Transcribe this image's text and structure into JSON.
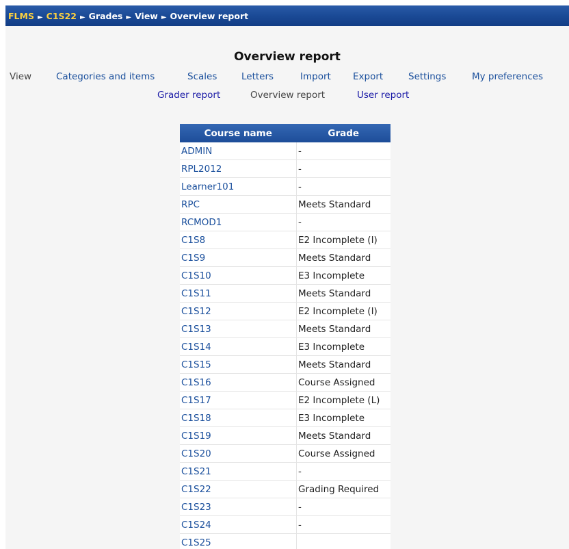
{
  "breadcrumb": {
    "items": [
      {
        "label": "FLMS",
        "link": true
      },
      {
        "label": "C1S22",
        "link": true
      },
      {
        "label": "Grades",
        "link": false
      },
      {
        "label": "View",
        "link": false
      },
      {
        "label": "Overview report",
        "link": false
      }
    ],
    "separator": "►"
  },
  "page_title": "Overview report",
  "tabs": [
    {
      "label": "View",
      "active": true
    },
    {
      "label": "Categories and items",
      "active": false
    },
    {
      "label": "Scales",
      "active": false
    },
    {
      "label": "Letters",
      "active": false
    },
    {
      "label": "Import",
      "active": false
    },
    {
      "label": "Export",
      "active": false
    },
    {
      "label": "Settings",
      "active": false
    },
    {
      "label": "My preferences",
      "active": false
    }
  ],
  "subtabs": [
    {
      "label": "Grader report",
      "active": false
    },
    {
      "label": "Overview report",
      "active": true
    },
    {
      "label": "User report",
      "active": false
    }
  ],
  "table": {
    "headers": [
      "Course name",
      "Grade"
    ],
    "rows": [
      {
        "course": "ADMIN",
        "grade": "-"
      },
      {
        "course": "RPL2012",
        "grade": "-"
      },
      {
        "course": "Learner101",
        "grade": "-"
      },
      {
        "course": "RPC",
        "grade": "Meets Standard"
      },
      {
        "course": "RCMOD1",
        "grade": "-"
      },
      {
        "course": "C1S8",
        "grade": "E2 Incomplete (I)"
      },
      {
        "course": "C1S9",
        "grade": "Meets Standard"
      },
      {
        "course": "C1S10",
        "grade": "E3 Incomplete"
      },
      {
        "course": "C1S11",
        "grade": "Meets Standard"
      },
      {
        "course": "C1S12",
        "grade": "E2 Incomplete (I)"
      },
      {
        "course": "C1S13",
        "grade": "Meets Standard"
      },
      {
        "course": "C1S14",
        "grade": "E3 Incomplete"
      },
      {
        "course": "C1S15",
        "grade": "Meets Standard"
      },
      {
        "course": "C1S16",
        "grade": "Course Assigned"
      },
      {
        "course": "C1S17",
        "grade": "E2 Incomplete (L)"
      },
      {
        "course": "C1S18",
        "grade": "E3 Incomplete"
      },
      {
        "course": "C1S19",
        "grade": "Meets Standard"
      },
      {
        "course": "C1S20",
        "grade": "Course Assigned"
      },
      {
        "course": "C1S21",
        "grade": "-"
      },
      {
        "course": "C1S22",
        "grade": "Grading Required"
      },
      {
        "course": "C1S23",
        "grade": "-"
      },
      {
        "course": "C1S24",
        "grade": "-"
      },
      {
        "course": "C1S25",
        "grade": ""
      }
    ]
  },
  "colors": {
    "navbar_bg": "#1b4a96",
    "breadcrumb_link": "#ffd23f",
    "link": "#1a4f9c",
    "subtab_link": "#1a1aa6",
    "page_bg": "#f5f5f5",
    "table_header_bg": "#1d4d99"
  }
}
